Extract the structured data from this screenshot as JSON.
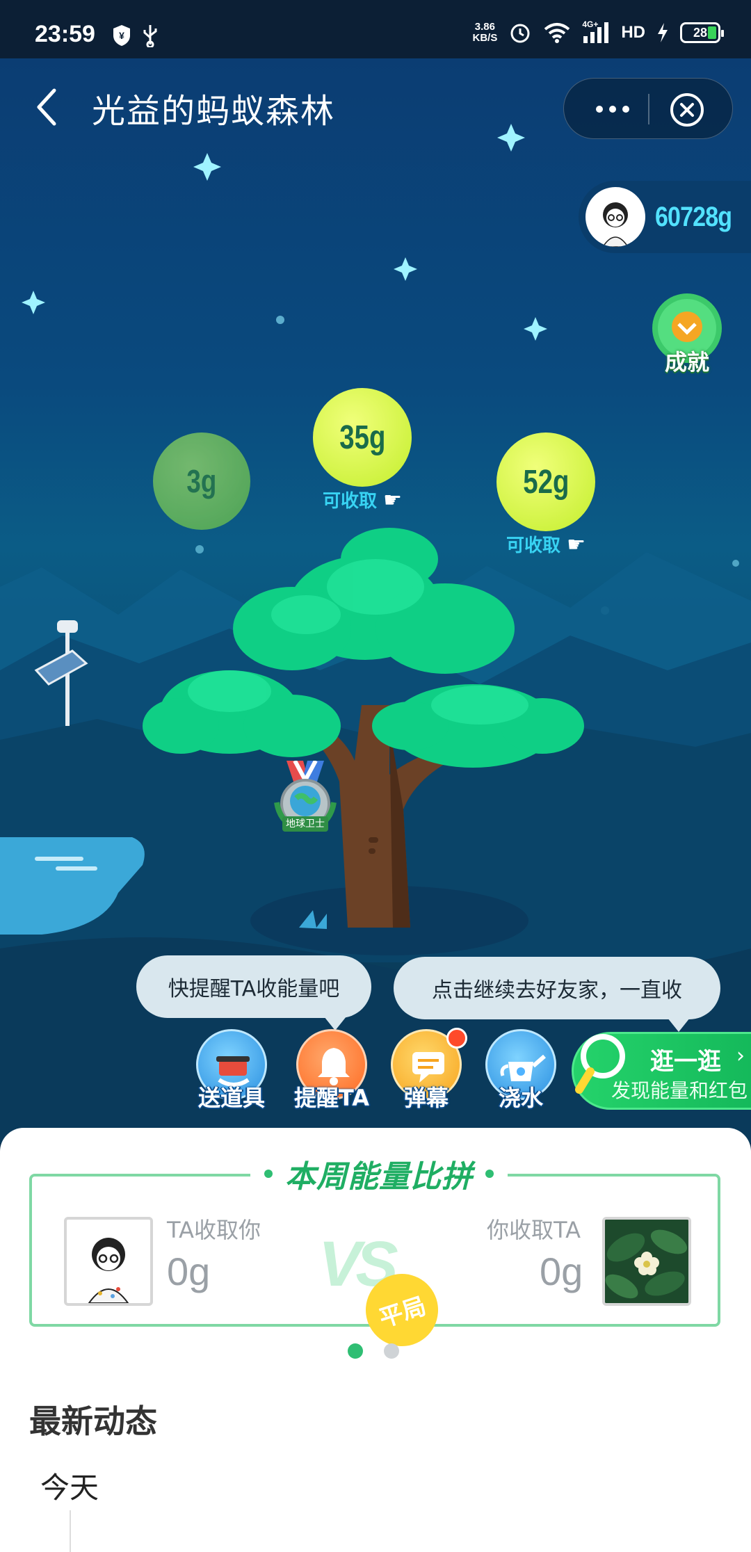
{
  "status_bar": {
    "time": "23:59",
    "net_speed_value": "3.86",
    "net_speed_unit": "KB/S",
    "network": "4G+",
    "hd": "HD",
    "battery": "28",
    "icons": [
      "shield-icon",
      "usb-icon",
      "alarm-icon",
      "wifi-icon",
      "signal-icon",
      "charging-icon"
    ]
  },
  "nav": {
    "title": "光益的蚂蚁森林"
  },
  "profile": {
    "energy_total": "60728g"
  },
  "achievement": {
    "label": "成就"
  },
  "energy_bubbles": [
    {
      "amount": "3g",
      "tip": ""
    },
    {
      "amount": "35g",
      "tip": "可收取"
    },
    {
      "amount": "52g",
      "tip": "可收取"
    }
  ],
  "badge": {
    "label": "地球卫士"
  },
  "hints": {
    "left": "快提醒TA收能量吧",
    "right": "点击继续去好友家，一直收"
  },
  "tools": [
    {
      "label": "送道具",
      "icon": "gift-tool-icon"
    },
    {
      "label": "提醒TA",
      "icon": "bell-icon"
    },
    {
      "label": "弹幕",
      "icon": "message-icon"
    },
    {
      "label": "浇水",
      "icon": "watering-can-icon"
    }
  ],
  "stroll": {
    "title": "逛一逛",
    "subtitle": "发现能量和红包",
    "chevron": "›"
  },
  "weekly_pk": {
    "title": "本周能量比拼",
    "left_caption": "TA收取你",
    "left_value": "0g",
    "right_caption": "你收取TA",
    "right_value": "0g",
    "vs": "VS",
    "result": "平局"
  },
  "pager": {
    "pages": 2,
    "active": 0
  },
  "feed": {
    "title": "最新动态",
    "day": "今天"
  },
  "colors": {
    "accent_green": "#2fbe73",
    "energy_cyan": "#53e2ff",
    "bubble_green": "#c8f23a"
  }
}
